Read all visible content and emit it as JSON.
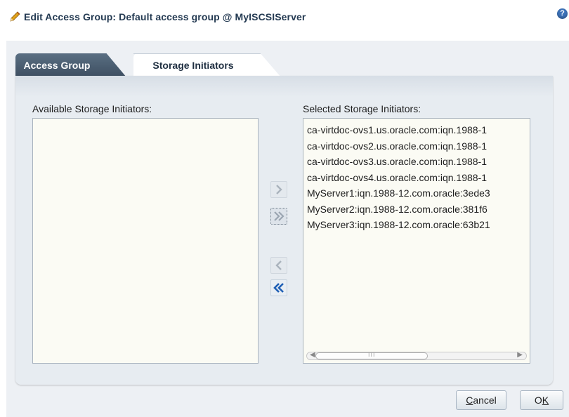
{
  "window": {
    "title": "Edit Access Group: Default access group @ MyISCSIServer",
    "help_glyph": "?"
  },
  "tabs": [
    {
      "label": "Access Group",
      "active": false
    },
    {
      "label": "Storage Initiators",
      "active": true
    }
  ],
  "available": {
    "label": "Available Storage Initiators:",
    "items": []
  },
  "selected": {
    "label": "Selected Storage Initiators:",
    "items": [
      "ca-virtdoc-ovs1.us.oracle.com:iqn.1988-1",
      "ca-virtdoc-ovs2.us.oracle.com:iqn.1988-1",
      "ca-virtdoc-ovs3.us.oracle.com:iqn.1988-1",
      "ca-virtdoc-ovs4.us.oracle.com:iqn.1988-1",
      "MyServer1:iqn.1988-12.com.oracle:3ede3",
      "MyServer2:iqn.1988-12.com.oracle:381f6",
      "MyServer3:iqn.1988-12.com.oracle:63b21"
    ],
    "scrollbar_grip": "III"
  },
  "shuttle": {
    "move_icon": "chevron-right-icon",
    "move_all_icon": "double-chevron-right-icon",
    "remove_icon": "chevron-left-icon",
    "remove_all_icon": "double-chevron-left-icon"
  },
  "footer": {
    "cancel": {
      "mnemonic": "C",
      "rest": "ancel"
    },
    "ok": {
      "mnemonic": "K",
      "prefix": "O"
    }
  },
  "colors": {
    "title": "#243a52",
    "tab_inactive": "#3d4e61",
    "panel": "#e7ecf1",
    "list_bg": "#fbfbf4",
    "accent_blue": "#1f5fb5"
  }
}
